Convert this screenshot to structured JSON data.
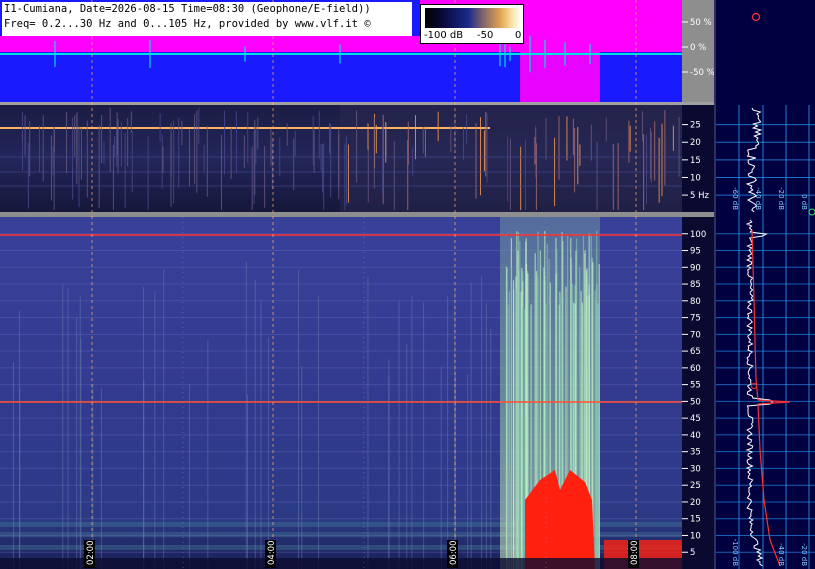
{
  "header": {
    "line1": "I1-Cumiana, Date=2026-08-15 Time=08:30 (Geophone/E-field))",
    "line2": "Freq= 0.2...30 Hz and 0...105 Hz, provided by www.vlf.it ©"
  },
  "colorbar": {
    "ticks": [
      "-100 dB",
      "-50",
      "0"
    ]
  },
  "chart_data": [
    {
      "type": "line",
      "panel": "field-signal",
      "yticks": [
        "50 %",
        "0 %",
        "-50 %"
      ],
      "ylim": [
        -100,
        100
      ],
      "colors": {
        "background": "#1a1aff",
        "trace": "#ff00ff",
        "baseline": "#00e0e0"
      }
    },
    {
      "type": "heatmap",
      "panel": "low-frequency-spectrogram",
      "ylabel_unit": "Hz",
      "yticks": [
        "25",
        "20",
        "15",
        "10",
        "5 Hz"
      ],
      "ylim": [
        0.2,
        30
      ],
      "colors": {
        "background": "#15153a",
        "marker": "#ff9a30"
      }
    },
    {
      "type": "heatmap",
      "panel": "main-spectrogram",
      "yticks": [
        "100",
        "95",
        "90",
        "85",
        "80",
        "75",
        "70",
        "65",
        "60",
        "55",
        "50",
        "45",
        "40",
        "35",
        "30",
        "25",
        "20",
        "15",
        "10",
        "5"
      ],
      "ylim": [
        0,
        105
      ],
      "xticks": [
        "02:00",
        "04:00",
        "06:00",
        "08:00"
      ],
      "colors": {
        "background": "#323a8a",
        "mains_line": "#ff3030",
        "burst": "#ff2010"
      }
    },
    {
      "type": "line",
      "panel": "average-spectrum-upper",
      "xticks": [
        "-60 dB",
        "-40 dB",
        "-20 dB",
        "0 dB"
      ],
      "colors": {
        "background": "#000040",
        "trace": "#ffffff",
        "grid": "#2aa0ff"
      }
    },
    {
      "type": "line",
      "panel": "average-spectrum-lower",
      "xticks": [
        "-100 dB",
        "-40 dB",
        "-20 dB"
      ],
      "peak_labels_hz": [
        100,
        50
      ],
      "colors": {
        "background": "#000040",
        "trace": "#ffffff",
        "curve": "#ff3030",
        "grid": "#2aa0ff"
      }
    }
  ]
}
